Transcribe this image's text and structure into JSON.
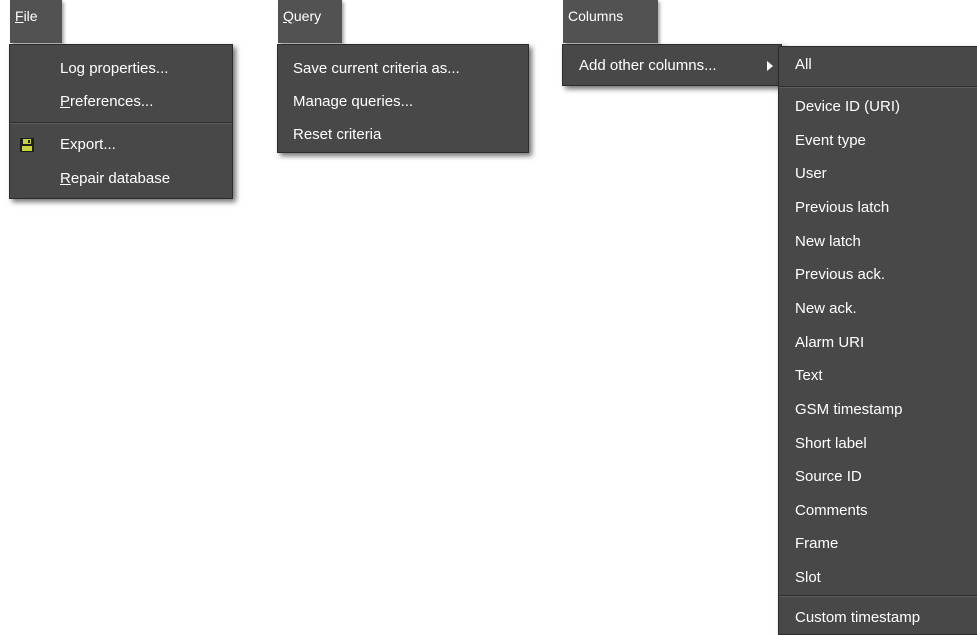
{
  "menus": {
    "file": {
      "tab_mnemonic": "F",
      "tab_rest": "ile",
      "items": {
        "log_properties": "Log properties...",
        "preferences_mnemonic": "P",
        "preferences_rest": "references...",
        "export": "Export...",
        "repair_mnemonic": "R",
        "repair_rest": "epair database"
      }
    },
    "query": {
      "tab_mnemonic": "Q",
      "tab_rest": "uery",
      "items": [
        "Save current criteria as...",
        "Manage queries...",
        "Reset criteria"
      ]
    },
    "columns": {
      "tab_label": "Columns",
      "items": [
        "Add other columns..."
      ]
    },
    "add_columns_submenu": {
      "all": "All",
      "items": [
        "Device ID (URI)",
        "Event type",
        "User",
        "Previous latch",
        "New latch",
        "Previous ack.",
        "New ack.",
        "Alarm URI",
        "Text",
        "GSM timestamp",
        "Short label",
        "Source ID",
        "Comments",
        "Frame",
        "Slot"
      ],
      "custom": "Custom timestamp"
    }
  },
  "icons": {
    "export": "save-icon"
  },
  "colors": {
    "menu_bg": "#484848",
    "tab_bg": "#525252",
    "text": "#ffffff",
    "icon_accent": "#c8d23c"
  }
}
